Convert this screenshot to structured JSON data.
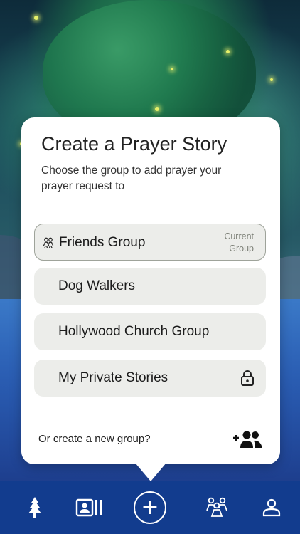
{
  "modal": {
    "title": "Create a Prayer Story",
    "subtitle": "Choose the group to add prayer your prayer request to",
    "groups": [
      {
        "label": "Friends Group",
        "badge": "Current Group"
      },
      {
        "label": "Dog Walkers"
      },
      {
        "label": "Hollywood Church Group"
      },
      {
        "label": "My Private Stories",
        "icon": "lock-icon"
      }
    ],
    "new_group_prompt": "Or create a new group?"
  },
  "tabbar": {
    "items": [
      {
        "icon": "tree-icon"
      },
      {
        "icon": "stories-icon"
      },
      {
        "icon": "add-icon",
        "glyph": "+"
      },
      {
        "icon": "groups-icon"
      },
      {
        "icon": "profile-icon"
      }
    ]
  },
  "colors": {
    "tabbar": "#123c8e",
    "card": "#ffffff",
    "group_bg": "#ecedea"
  }
}
